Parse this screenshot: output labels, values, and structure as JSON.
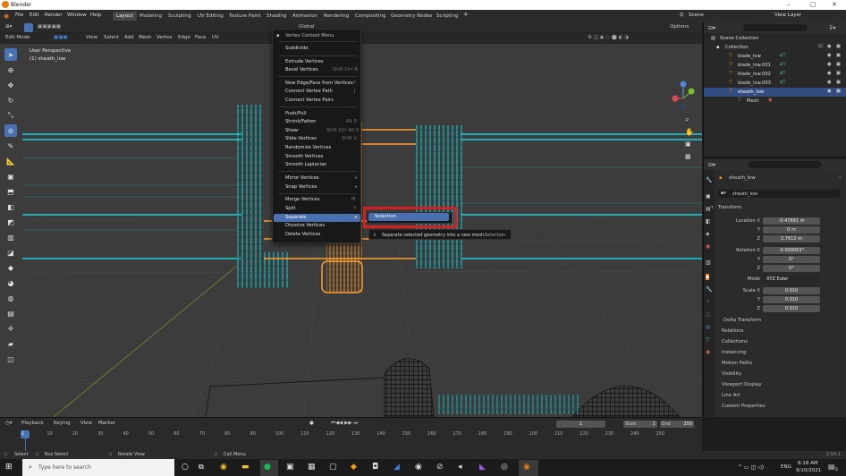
{
  "window": {
    "title": "Blender"
  },
  "menubar": {
    "menus": [
      "File",
      "Edit",
      "Render",
      "Window",
      "Help"
    ],
    "workspaces": [
      "Layout",
      "Modeling",
      "Sculpting",
      "UV Editing",
      "Texture Paint",
      "Shading",
      "Animation",
      "Rendering",
      "Compositing",
      "Geometry Nodes",
      "Scripting"
    ],
    "active_workspace": "Layout",
    "scene": "Scene",
    "view_layer": "View Layer"
  },
  "viewport_header": {
    "mode": "Edit Mode",
    "menus": [
      "View",
      "Select",
      "Add",
      "Mesh",
      "Vertex",
      "Edge",
      "Face",
      "UV"
    ],
    "transform": "Global",
    "options": "Options"
  },
  "viewport": {
    "perspective": "User Perspective",
    "object": "(1) sheath_low"
  },
  "context_menu": {
    "title": "Vertex Context Menu",
    "items": [
      {
        "label": "Subdivide",
        "shortcut": ""
      },
      {
        "label": "Extrude Vertices",
        "shortcut": ""
      },
      {
        "label": "Bevel Vertices",
        "shortcut": "Shift Ctrl B"
      },
      {
        "label": "New Edge/Face from Vertices",
        "shortcut": "F"
      },
      {
        "label": "Connect Vertex Path",
        "shortcut": "J"
      },
      {
        "label": "Connect Vertex Pairs",
        "shortcut": ""
      },
      {
        "label": "Push/Pull",
        "shortcut": ""
      },
      {
        "label": "Shrink/Fatten",
        "shortcut": "Alt S"
      },
      {
        "label": "Shear",
        "shortcut": "Shift Ctrl Alt S"
      },
      {
        "label": "Slide Vertices",
        "shortcut": "Shift V"
      },
      {
        "label": "Randomize Vertices",
        "shortcut": ""
      },
      {
        "label": "Smooth Vertices",
        "shortcut": ""
      },
      {
        "label": "Smooth Laplacian",
        "shortcut": ""
      },
      {
        "label": "Mirror Vertices",
        "shortcut": ""
      },
      {
        "label": "Snap Vertices",
        "shortcut": ""
      },
      {
        "label": "Merge Vertices",
        "shortcut": "M"
      },
      {
        "label": "Split",
        "shortcut": "Y"
      },
      {
        "label": "Separate",
        "shortcut": "P"
      },
      {
        "label": "Dissolve Vertices",
        "shortcut": ""
      },
      {
        "label": "Delete Vertices",
        "shortcut": ""
      }
    ],
    "submenu_item": "Selection",
    "tooltip": "Separate selected geometry into a new mesh:",
    "tooltip_value": "Selection"
  },
  "outliner": {
    "rows": [
      "Scene Collection",
      "Collection",
      "blade_low",
      "blade_low.001",
      "blade_low.002",
      "blade_low.003",
      "sheath_low",
      "Mesh"
    ],
    "selected": "sheath_low"
  },
  "properties": {
    "object_name": "sheath_low",
    "data_name": "sheath_low",
    "panel": "Transform",
    "location_label": "Location X",
    "location": [
      "-0.47891 m",
      "0 m",
      "2.7612 m"
    ],
    "rotation_label": "Rotation X",
    "rotation": [
      "-0.000003°",
      "0°",
      "0°"
    ],
    "mode_label": "Mode",
    "mode": "XYZ Euler",
    "scale_label": "Scale X",
    "scale": [
      "0.010",
      "0.010",
      "0.010"
    ],
    "axis_labels": [
      "Y",
      "Z"
    ],
    "delta": "Delta Transform",
    "sections": [
      "Relations",
      "Collections",
      "Instancing",
      "Motion Paths",
      "Visibility",
      "Viewport Display",
      "Line Art",
      "Custom Properties"
    ]
  },
  "timeline": {
    "menus": [
      "Playback",
      "Keying",
      "View",
      "Marker"
    ],
    "current_frame": "1",
    "start_label": "Start",
    "start": "1",
    "end_label": "End",
    "end": "250",
    "ticks": [
      "1",
      "10",
      "20",
      "30",
      "40",
      "50",
      "60",
      "70",
      "80",
      "90",
      "100",
      "110",
      "120",
      "130",
      "140",
      "150",
      "160",
      "170",
      "180",
      "190",
      "200",
      "210",
      "220",
      "230",
      "240",
      "250"
    ]
  },
  "statusbar": {
    "items": [
      "Select",
      "Box Select",
      "Rotate View",
      "Call Menu"
    ],
    "version": "2.93.1"
  },
  "taskbar": {
    "search_placeholder": "Type here to search",
    "language": "ENG",
    "time": "8:18 AM",
    "date": "9/10/2021",
    "notifications": "5"
  },
  "colors": {
    "accent": "#4772b3",
    "wire_selected": "#ff9a1f",
    "wire": "#22c8d4",
    "highlight_box": "#d42020"
  }
}
